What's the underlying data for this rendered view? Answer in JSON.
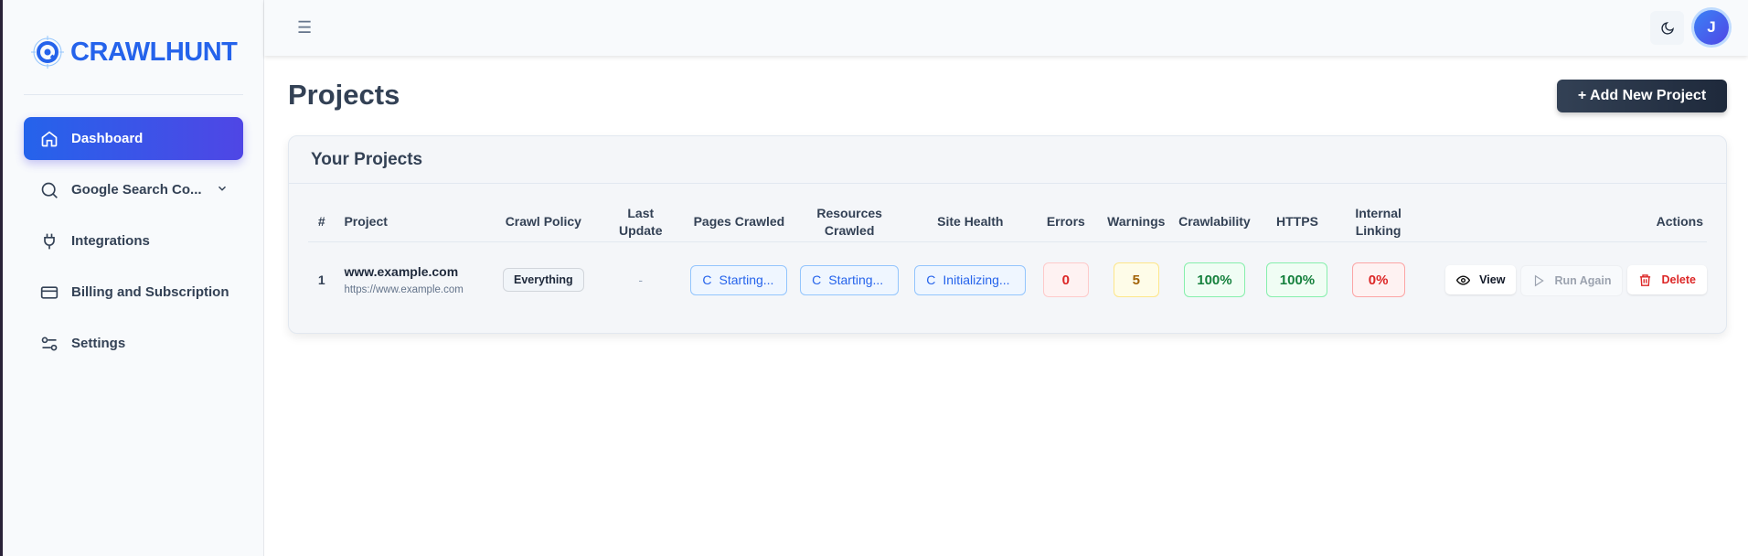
{
  "brand": {
    "name": "CRAWLHUNT",
    "color": "#2563eb"
  },
  "sidebar": {
    "items": [
      {
        "label": "Dashboard",
        "icon": "home-icon",
        "active": true
      },
      {
        "label": "Google Search Co...",
        "icon": "search-icon",
        "has_submenu": true
      },
      {
        "label": "Integrations",
        "icon": "plug-icon"
      },
      {
        "label": "Billing and Subscription",
        "icon": "credit-card-icon"
      },
      {
        "label": "Settings",
        "icon": "sliders-icon"
      }
    ]
  },
  "topbar": {
    "menu_icon": "☰",
    "avatar_initial": "J"
  },
  "page": {
    "title": "Projects",
    "add_button": "+ Add New Project"
  },
  "card": {
    "title": "Your Projects"
  },
  "table": {
    "headers": [
      "#",
      "Project",
      "Crawl Policy",
      "Last Update",
      "Pages Crawled",
      "Resources Crawled",
      "Site Health",
      "Errors",
      "Warnings",
      "Crawlability",
      "HTTPS",
      "Internal Linking",
      "Actions"
    ],
    "rows": [
      {
        "index": "1",
        "name": "www.example.com",
        "url": "https://www.example.com",
        "policy": "Everything",
        "last_update": "-",
        "pages": "Starting...",
        "resources": "Starting...",
        "health": "Initializing...",
        "errors": "0",
        "warnings": "5",
        "crawlability": "100%",
        "https": "100%",
        "internal_linking": "0%",
        "actions": {
          "view": "View",
          "run": "Run Again",
          "delete": "Delete"
        }
      }
    ]
  },
  "colors": {
    "error": "#dc2626",
    "warning": "#a16207",
    "success": "#15803d",
    "info": "#2563eb"
  }
}
